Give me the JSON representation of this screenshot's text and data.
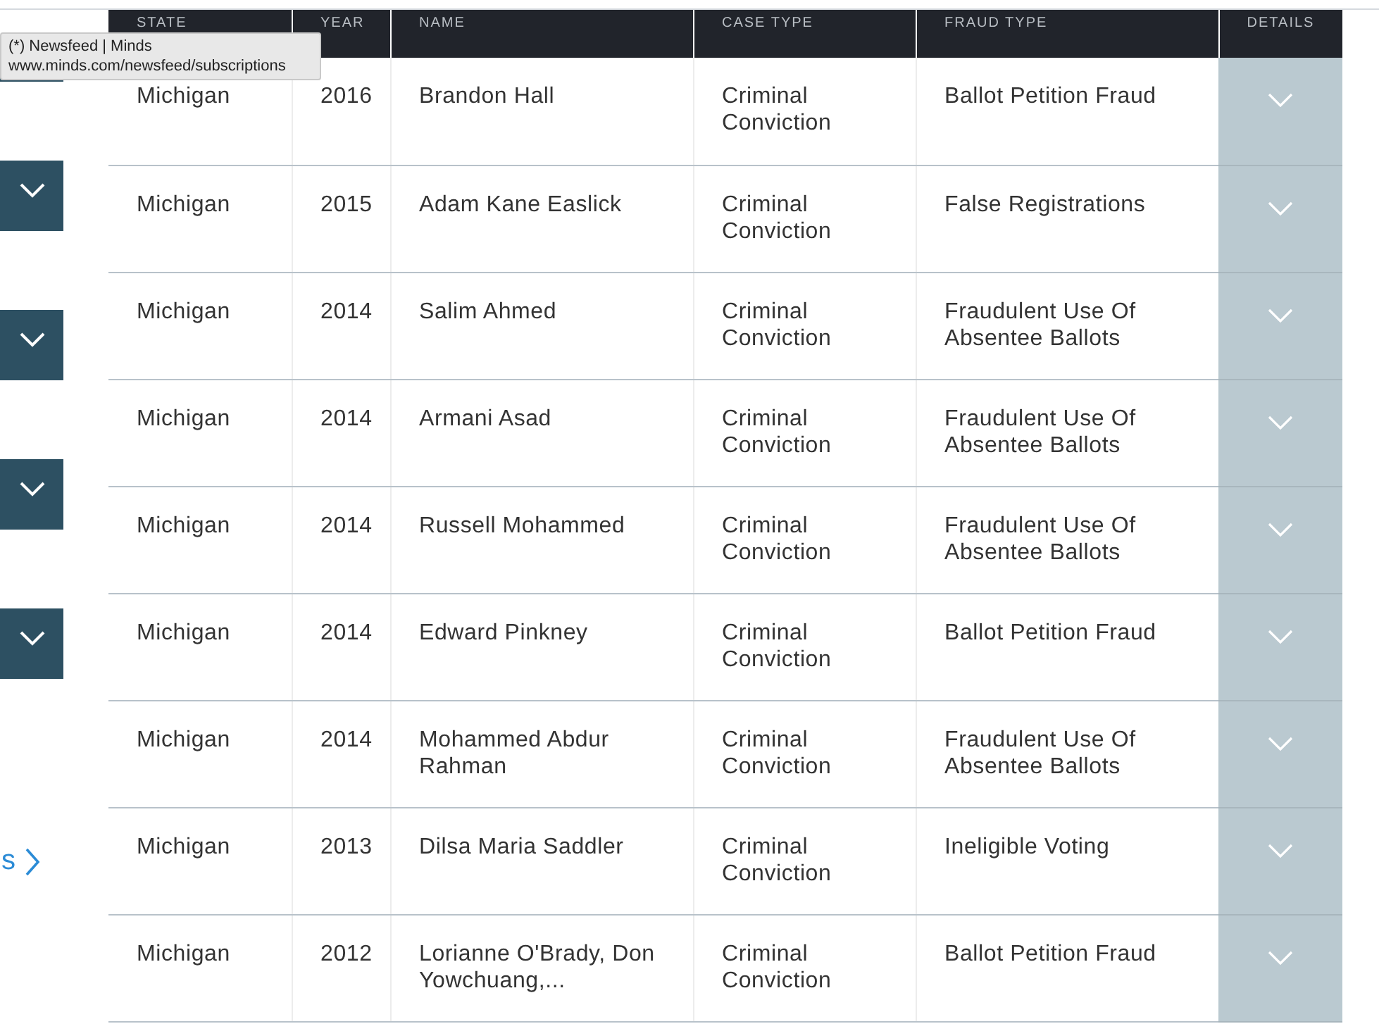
{
  "tooltip": {
    "title": "(*) Newsfeed | Minds",
    "url": "www.minds.com/newsfeed/subscriptions"
  },
  "sidebar": {
    "link_text": "s"
  },
  "table": {
    "columns": [
      "STATE",
      "YEAR",
      "NAME",
      "CASE TYPE",
      "FRAUD TYPE",
      "DETAILS"
    ],
    "rows": [
      {
        "state": "Michigan",
        "year": "2016",
        "name": "Brandon Hall",
        "case_type": "Criminal Conviction",
        "fraud_type": "Ballot Petition Fraud",
        "expanded": false
      },
      {
        "state": "Michigan",
        "year": "2015",
        "name": "Adam Kane Easlick",
        "case_type": "Criminal Conviction",
        "fraud_type": "False Registrations",
        "expanded": false
      },
      {
        "state": "Michigan",
        "year": "2014",
        "name": "Salim Ahmed",
        "case_type": "Criminal Conviction",
        "fraud_type": "Fraudulent Use Of Absentee Ballots",
        "expanded": false
      },
      {
        "state": "Michigan",
        "year": "2014",
        "name": "Armani Asad",
        "case_type": "Criminal Conviction",
        "fraud_type": "Fraudulent Use Of Absentee Ballots",
        "expanded": false
      },
      {
        "state": "Michigan",
        "year": "2014",
        "name": "Russell Mohammed",
        "case_type": "Criminal Conviction",
        "fraud_type": "Fraudulent Use Of Absentee Ballots",
        "expanded": false
      },
      {
        "state": "Michigan",
        "year": "2014",
        "name": "Edward Pinkney",
        "case_type": "Criminal Conviction",
        "fraud_type": "Ballot Petition Fraud",
        "expanded": false
      },
      {
        "state": "Michigan",
        "year": "2014",
        "name": "Mohammed Abdur Rahman",
        "case_type": "Criminal Conviction",
        "fraud_type": "Fraudulent Use Of Absentee Ballots",
        "expanded": false
      },
      {
        "state": "Michigan",
        "year": "2013",
        "name": "Dilsa Maria Saddler",
        "case_type": "Criminal Conviction",
        "fraud_type": "Ineligible Voting",
        "expanded": false
      },
      {
        "state": "Michigan",
        "year": "2012",
        "name": "Lorianne O'Brady, Don Yowchuang,...",
        "case_type": "Criminal Conviction",
        "fraud_type": "Ballot Petition Fraud",
        "expanded": false
      }
    ]
  }
}
